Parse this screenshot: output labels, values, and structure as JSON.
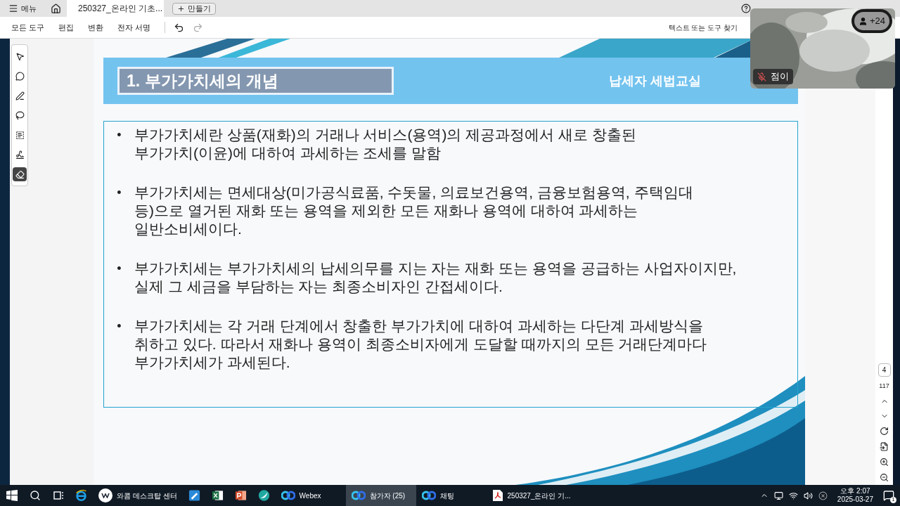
{
  "app_tabs": {
    "menu_label": "메뉴",
    "document_tab": {
      "title": "250327_온라인 기초...",
      "selected": true
    },
    "new_button": "만들기"
  },
  "toolbar": {
    "items": [
      "모든 도구",
      "편집",
      "변환",
      "전자 서명"
    ],
    "find_button": "텍스트 또는 도구 찾기"
  },
  "tool_rail": [
    {
      "kind": "select",
      "selected": false
    },
    {
      "kind": "comment",
      "selected": false
    },
    {
      "kind": "draw",
      "selected": false
    },
    {
      "kind": "lasso",
      "selected": false
    },
    {
      "kind": "text",
      "selected": false
    },
    {
      "kind": "sign",
      "selected": false
    },
    {
      "kind": "eraser",
      "selected": true
    }
  ],
  "slide": {
    "title": "1. 부가가치세의 개념",
    "subtitle": "납세자 세법교실",
    "bullets": [
      {
        "marker": "•",
        "lines": [
          "부가가치세란 상품(재화)의 거래나 서비스(용역)의 제공과정에서 새로 창출된",
          "부가가치(이윤)에 대하여 과세하는 조세를 말함"
        ]
      },
      {
        "marker": "•",
        "lines": [
          "부가가치세는 면세대상(미가공식료품, 수돗물, 의료보건용역, 금융보험용역, 주택임대",
          "등)으로 열거된 재화 또는 용역을 제외한 모든 재화나 용역에 대하여 과세하는",
          "일반소비세이다."
        ]
      },
      {
        "marker": "•",
        "lines": [
          "부가가치세는 부가가치세의 납세의무를 지는 자는 재화 또는 용역을 공급하는 사업자이지만,",
          "실제 그 세금을 부담하는 자는 최종소비자인 간접세이다."
        ]
      },
      {
        "marker": "•",
        "lines": [
          "부가가치세는 각 거래 단계에서 창출한 부가가치에 대하여 과세하는 다단계 과세방식을",
          "취하고 있다. 따라서 재화나 용역이 최종소비자에게 도달할 때까지의 모든 거래단계마다",
          "부가가치세가 과세된다."
        ]
      }
    ]
  },
  "page_nav": {
    "current_page": "4",
    "total_pages": "117"
  },
  "video": {
    "participants_badge": "+24",
    "name": "점이",
    "muted": true
  },
  "taskbar": {
    "apps": [
      {
        "kind": "start",
        "selected": false
      },
      {
        "kind": "search",
        "selected": false
      },
      {
        "kind": "taskview",
        "selected": false
      },
      {
        "kind": "ie",
        "selected": false
      },
      {
        "kind": "wacom",
        "label": "와콤 데스크탑 센터",
        "selected": false
      },
      {
        "kind": "pen",
        "selected": false
      },
      {
        "kind": "excel",
        "selected": false
      },
      {
        "kind": "powerpoint",
        "selected": false
      },
      {
        "kind": "round",
        "selected": false
      },
      {
        "kind": "webex",
        "label": "Webex",
        "selected": false
      },
      {
        "kind": "webex",
        "label": "참가자 (25)",
        "selected": true
      },
      {
        "kind": "webex",
        "label": "채팅",
        "selected": false
      },
      {
        "kind": "pdf",
        "label": "250327_온라인 기...",
        "selected": false
      }
    ],
    "clock": {
      "time": "오후 2:07",
      "date": "2025-03-27"
    },
    "notification_count": "1"
  }
}
